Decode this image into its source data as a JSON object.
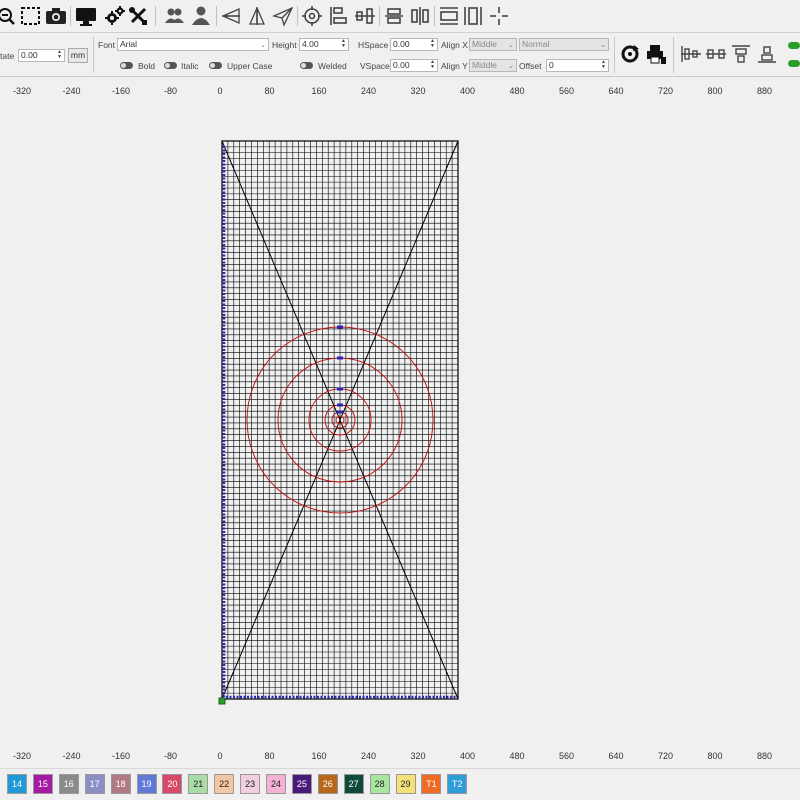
{
  "colors": {
    "grid": "#000000",
    "circles": "#c01818",
    "selection_marker": "#2626b8",
    "origin_marker": "#2e9e2e"
  },
  "toolbar": {
    "icons": [
      "zoom-out-icon",
      "select-region-icon",
      "camera-icon",
      "monitor-icon",
      "gears-icon",
      "tools-icon",
      "users-icon",
      "user-icon",
      "mirror-horizontal-icon",
      "mirror-vertical-icon",
      "send-icon",
      "target-icon",
      "align-left-icon",
      "align-center-icon",
      "distribute-vertical-icon",
      "distribute-horizontal-icon",
      "same-size-icon",
      "grid-snap-icon"
    ]
  },
  "props": {
    "rotate_label": "tate",
    "rotate_value": "0.00",
    "unit_button": "mm",
    "font_label": "Font",
    "font_value": "Arial",
    "height_label": "Height",
    "height_value": "4.00",
    "hspace_label": "HSpace",
    "hspace_value": "0.00",
    "vspace_label": "VSpace",
    "vspace_value": "0.00",
    "alignx_label": "Align X",
    "alignx_value": "Middle",
    "aligny_label": "Align Y",
    "aligny_value": "Middle",
    "style_value": "Normal",
    "offset_label": "Offset",
    "offset_value": "0",
    "bold_label": "Bold",
    "italic_label": "Italic",
    "uppercase_label": "Upper Case",
    "welded_label": "Welded"
  },
  "ruler": {
    "labels": [
      "-320",
      "-240",
      "-160",
      "-80",
      "0",
      "80",
      "160",
      "240",
      "320",
      "400",
      "480",
      "560",
      "640",
      "720",
      "800",
      "880"
    ]
  },
  "palette": [
    {
      "label": "14",
      "color": "#1f9ad6"
    },
    {
      "label": "15",
      "color": "#a51aa5"
    },
    {
      "label": "16",
      "color": "#8a8a8a"
    },
    {
      "label": "17",
      "color": "#8b8fc4"
    },
    {
      "label": "18",
      "color": "#b07a84"
    },
    {
      "label": "19",
      "color": "#5f79d6"
    },
    {
      "label": "20",
      "color": "#d94a6a"
    },
    {
      "label": "21",
      "color": "#a9dca6"
    },
    {
      "label": "22",
      "color": "#f2c7a6"
    },
    {
      "label": "23",
      "color": "#f2cfe0"
    },
    {
      "label": "24",
      "color": "#f5b1d3"
    },
    {
      "label": "25",
      "color": "#4a1a7a"
    },
    {
      "label": "26",
      "color": "#b8681a"
    },
    {
      "label": "27",
      "color": "#0e4a3a"
    },
    {
      "label": "28",
      "color": "#a8e6a0"
    },
    {
      "label": "29",
      "color": "#f5e07a"
    },
    {
      "label": "T1",
      "color": "#ef6a24"
    },
    {
      "label": "T2",
      "color": "#2e9ed8"
    }
  ]
}
